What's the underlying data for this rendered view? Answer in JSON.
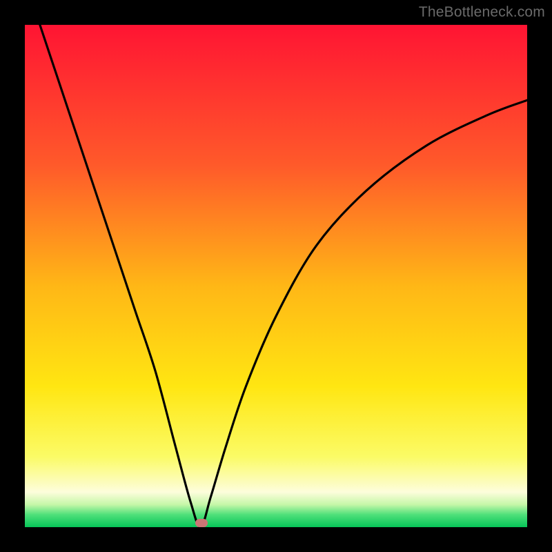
{
  "watermark": {
    "label": "TheBottleneck.com"
  },
  "colors": {
    "bg": "#000000",
    "marker": "#cb7575",
    "curve_stroke": "#000000",
    "gradient_stops": [
      {
        "offset": 0.0,
        "color": "#ff1433"
      },
      {
        "offset": 0.28,
        "color": "#ff5a2a"
      },
      {
        "offset": 0.52,
        "color": "#ffb716"
      },
      {
        "offset": 0.72,
        "color": "#ffe612"
      },
      {
        "offset": 0.86,
        "color": "#fbfb66"
      },
      {
        "offset": 0.93,
        "color": "#fdfddc"
      },
      {
        "offset": 0.955,
        "color": "#c6f7a8"
      },
      {
        "offset": 0.975,
        "color": "#4fe07a"
      },
      {
        "offset": 1.0,
        "color": "#06c558"
      }
    ]
  },
  "chart_data": {
    "type": "line",
    "title": "",
    "xlabel": "",
    "ylabel": "",
    "xlim": [
      0,
      100
    ],
    "ylim": [
      0,
      100
    ],
    "minimum_x": 35,
    "series": [
      {
        "name": "curve",
        "x": [
          3,
          6,
          10,
          14,
          18,
          22,
          26,
          30,
          33,
          35,
          37,
          40,
          44,
          50,
          58,
          68,
          80,
          92,
          100
        ],
        "y": [
          100,
          91,
          79,
          67,
          55,
          43,
          31,
          16,
          5,
          0,
          6,
          16,
          28,
          42,
          56,
          67,
          76,
          82,
          85
        ]
      }
    ],
    "marker": {
      "x": 35.2,
      "y": 0.8
    },
    "grid": false,
    "legend": false
  }
}
